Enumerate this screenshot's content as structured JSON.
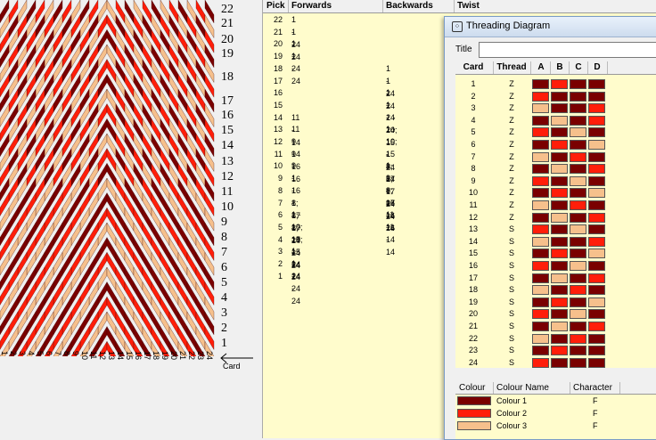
{
  "colors": {
    "c1": "#7a0000",
    "c2": "#ff1e0a",
    "c3": "#f6c08c"
  },
  "pattern": {
    "pick_numbers": [
      "22",
      "21",
      "20",
      "19",
      "18",
      "17",
      "16",
      "15",
      "14",
      "13",
      "12",
      "11",
      "10",
      "9",
      "8",
      "7",
      "6",
      "5",
      "4",
      "3",
      "2",
      "1"
    ],
    "card_numbers": [
      "1",
      "2",
      "3",
      "4",
      "5",
      "6",
      "7",
      "8",
      "9",
      "10",
      "11",
      "12",
      "13",
      "14",
      "15",
      "16",
      "17",
      "18",
      "19",
      "20",
      "21",
      "22",
      "23",
      "24"
    ],
    "card_axis_label": "Card"
  },
  "pick_table": {
    "headers": {
      "pick": "Pick",
      "forwards": "Forwards",
      "backwards": "Backwards",
      "twist": "Twist"
    },
    "rows": [
      {
        "pick": "22",
        "forwards": "1 - 24",
        "backwards": ""
      },
      {
        "pick": "21",
        "forwards": "1 - 24",
        "backwards": ""
      },
      {
        "pick": "20",
        "forwards": "1 - 24",
        "backwards": ""
      },
      {
        "pick": "19",
        "forwards": "1 - 24",
        "backwards": ""
      },
      {
        "pick": "18",
        "forwards": "",
        "backwards": "1 - 24"
      },
      {
        "pick": "17",
        "forwards": "",
        "backwards": "1 - 24"
      },
      {
        "pick": "16",
        "forwards": "",
        "backwards": "1 - 24"
      },
      {
        "pick": "15",
        "forwards": "",
        "backwards": "1 - 24"
      },
      {
        "pick": "14",
        "forwards": "11 - 14",
        "backwards": "1 - 10; 15 - 24"
      },
      {
        "pick": "13",
        "forwards": "11 - 14",
        "backwards": "1 - 10; 15 - 24"
      },
      {
        "pick": "12",
        "forwards": "9 - 16",
        "backwards": "1 - 8; 17 - 24"
      },
      {
        "pick": "11",
        "forwards": "9 - 16",
        "backwards": "1 - 8; 17 - 24"
      },
      {
        "pick": "10",
        "forwards": "9 - 16",
        "backwards": "1 - 8; 17 - 24"
      },
      {
        "pick": "9",
        "forwards": "1 - 8; 17 - 24",
        "backwards": "9 - 16"
      },
      {
        "pick": "8",
        "forwards": "1 - 8; 17 - 24",
        "backwards": "9 - 16"
      },
      {
        "pick": "7",
        "forwards": "1 - 8; 17 - 24",
        "backwards": "9 - 16"
      },
      {
        "pick": "6",
        "forwards": "1 - 10; 15 - 24",
        "backwards": "11 - 14"
      },
      {
        "pick": "5",
        "forwards": "1 - 10; 15 - 24",
        "backwards": "11 - 14"
      },
      {
        "pick": "4",
        "forwards": "1 - 24",
        "backwards": ""
      },
      {
        "pick": "3",
        "forwards": "1 - 24",
        "backwards": ""
      },
      {
        "pick": "2",
        "forwards": "1 - 24",
        "backwards": ""
      },
      {
        "pick": "1",
        "forwards": "1 - 24",
        "backwards": ""
      }
    ]
  },
  "threading_window": {
    "title": "Threading Diagram",
    "icon": "threading-window-icon",
    "title_field_label": "Title",
    "title_field_value": "",
    "headers": {
      "card": "Card",
      "thread": "Thread",
      "a": "A",
      "b": "B",
      "c": "C",
      "d": "D"
    },
    "rows": [
      {
        "card": "1",
        "thread": "Z",
        "holes": [
          1,
          2,
          1,
          1
        ]
      },
      {
        "card": "2",
        "thread": "Z",
        "holes": [
          2,
          1,
          1,
          1
        ]
      },
      {
        "card": "3",
        "thread": "Z",
        "holes": [
          3,
          1,
          1,
          2
        ]
      },
      {
        "card": "4",
        "thread": "Z",
        "holes": [
          1,
          3,
          1,
          2
        ]
      },
      {
        "card": "5",
        "thread": "Z",
        "holes": [
          2,
          1,
          3,
          1
        ]
      },
      {
        "card": "6",
        "thread": "Z",
        "holes": [
          1,
          2,
          1,
          3
        ]
      },
      {
        "card": "7",
        "thread": "Z",
        "holes": [
          3,
          1,
          2,
          1
        ]
      },
      {
        "card": "8",
        "thread": "Z",
        "holes": [
          1,
          3,
          1,
          2
        ]
      },
      {
        "card": "9",
        "thread": "Z",
        "holes": [
          2,
          1,
          3,
          1
        ]
      },
      {
        "card": "10",
        "thread": "Z",
        "holes": [
          1,
          2,
          1,
          3
        ]
      },
      {
        "card": "11",
        "thread": "Z",
        "holes": [
          3,
          1,
          2,
          1
        ]
      },
      {
        "card": "12",
        "thread": "Z",
        "holes": [
          1,
          3,
          1,
          2
        ]
      },
      {
        "card": "13",
        "thread": "S",
        "holes": [
          2,
          1,
          3,
          1
        ]
      },
      {
        "card": "14",
        "thread": "S",
        "holes": [
          3,
          1,
          1,
          2
        ]
      },
      {
        "card": "15",
        "thread": "S",
        "holes": [
          1,
          2,
          1,
          3
        ]
      },
      {
        "card": "16",
        "thread": "S",
        "holes": [
          2,
          1,
          3,
          1
        ]
      },
      {
        "card": "17",
        "thread": "S",
        "holes": [
          1,
          3,
          1,
          2
        ]
      },
      {
        "card": "18",
        "thread": "S",
        "holes": [
          3,
          1,
          2,
          1
        ]
      },
      {
        "card": "19",
        "thread": "S",
        "holes": [
          1,
          2,
          1,
          3
        ]
      },
      {
        "card": "20",
        "thread": "S",
        "holes": [
          2,
          1,
          3,
          1
        ]
      },
      {
        "card": "21",
        "thread": "S",
        "holes": [
          1,
          3,
          1,
          2
        ]
      },
      {
        "card": "22",
        "thread": "S",
        "holes": [
          3,
          1,
          2,
          1
        ]
      },
      {
        "card": "23",
        "thread": "S",
        "holes": [
          1,
          2,
          1,
          1
        ]
      },
      {
        "card": "24",
        "thread": "S",
        "holes": [
          2,
          1,
          1,
          1
        ]
      }
    ],
    "colour_table": {
      "headers": {
        "colour": "Colour",
        "colour_name": "Colour Name",
        "character": "Character"
      },
      "rows": [
        {
          "color_key": "c1",
          "name": "Colour 1",
          "character": "F"
        },
        {
          "color_key": "c2",
          "name": "Colour 2",
          "character": "F"
        },
        {
          "color_key": "c3",
          "name": "Colour 3",
          "character": "F"
        }
      ]
    }
  }
}
